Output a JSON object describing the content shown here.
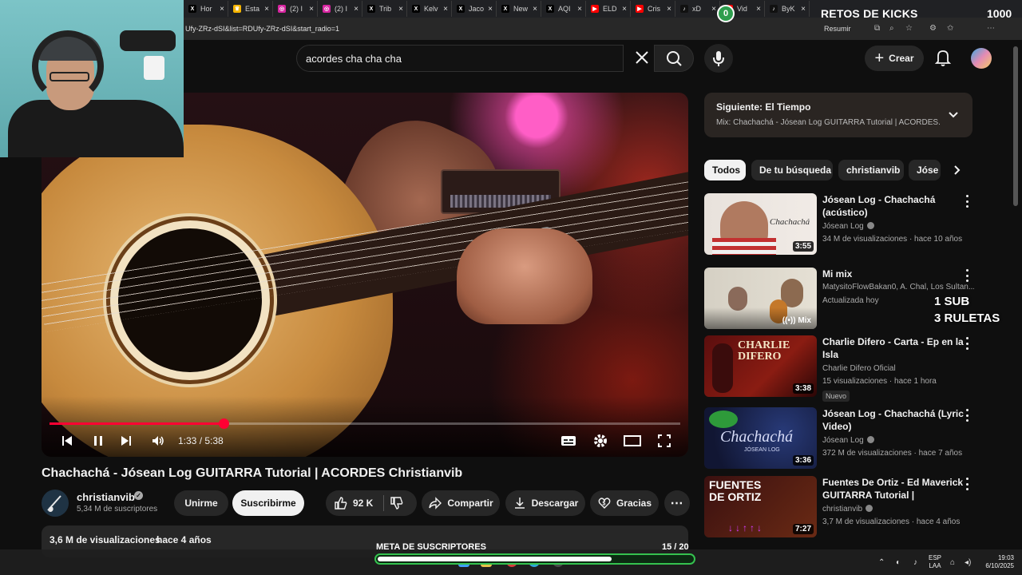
{
  "browser": {
    "tabs": [
      {
        "label": "Hor",
        "icon": "x-icon",
        "color": "#000000"
      },
      {
        "label": "Esta",
        "icon": "crown-icon",
        "color": "#f5b400"
      },
      {
        "label": "(2) I",
        "icon": "instagram-icon",
        "color": "#d6249f"
      },
      {
        "label": "(2) I",
        "icon": "instagram-icon",
        "color": "#d6249f"
      },
      {
        "label": "Trib",
        "icon": "x-icon",
        "color": "#000000"
      },
      {
        "label": "Kelv",
        "icon": "x-icon",
        "color": "#000000"
      },
      {
        "label": "Jaco",
        "icon": "x-icon",
        "color": "#000000"
      },
      {
        "label": "New",
        "icon": "x-icon",
        "color": "#000000"
      },
      {
        "label": "AQI",
        "icon": "x-icon",
        "color": "#000000"
      },
      {
        "label": "ELD",
        "icon": "youtube-icon",
        "color": "#ff0000"
      },
      {
        "label": "Cris",
        "icon": "youtube-icon",
        "color": "#ff0000"
      },
      {
        "label": "xD",
        "icon": "tiktok-icon",
        "color": "#111111"
      },
      {
        "label": "Vid",
        "icon": "youtube-icon",
        "color": "#ff0000"
      },
      {
        "label": "ByK",
        "icon": "tiktok-icon",
        "color": "#111111"
      }
    ],
    "url": "Ufy-ZRz-dSI&list=RDUfy-ZRz-dSI&start_radio=1",
    "resumir_label": "Resumir"
  },
  "stream": {
    "counter": "0",
    "challenge_title": "RETOS DE KICKS",
    "challenge_value": "1000",
    "sub_overlay": [
      "1 SUB",
      "3 RULETAS"
    ],
    "goal_label": "META DE SUSCRIPTORES",
    "goal_count": "15  / 20",
    "goal_progress": 0.75
  },
  "header": {
    "search_value": "acordes cha cha cha",
    "create_label": "Crear"
  },
  "player": {
    "time": "1:33 / 5:38",
    "progress": 0.276
  },
  "video": {
    "title": "Chachachá - Jósean Log GUITARRA Tutorial | ACORDES Christianvib",
    "channel": "christianvib",
    "subscribers": "5,34 M de suscriptores",
    "join_label": "Unirme",
    "subscribe_label": "Suscribirme",
    "likes": "92 K",
    "share_label": "Compartir",
    "download_label": "Descargar",
    "thanks_label": "Gracias",
    "views": "3,6 M de visualizaciones",
    "ago": "hace 4 años"
  },
  "playlist": {
    "next": "Siguiente: El Tiempo",
    "subtitle": "Mix: Chachachá - Jósean Log GUITARRA Tutorial | ACORDES..."
  },
  "chips": [
    "Todos",
    "De tu búsqueda",
    "christianvib",
    "Jóse"
  ],
  "recommendations": [
    {
      "title": "Jósean Log - Chachachá (acústico)",
      "channel": "Jósean Log",
      "verified": true,
      "meta": "34 M de visualizaciones · hace 10 años",
      "duration": "3:55",
      "badge": ""
    },
    {
      "title": "Mi mix",
      "channel": "MatysitoFlowBakan0, A. Chal, Los Sultan...",
      "verified": false,
      "meta": "Actualizada hoy",
      "duration": "Mix",
      "badge": ""
    },
    {
      "title": "Charlie Difero - Carta - Ep en la Isla",
      "channel": "Charlie Difero Oficial",
      "verified": false,
      "meta": "15 visualizaciones · hace 1 hora",
      "duration": "3:38",
      "badge": "Nuevo"
    },
    {
      "title": "Jósean Log - Chachachá (Lyric Video)",
      "channel": "Jósean Log",
      "verified": true,
      "meta": "372 M de visualizaciones · hace 7 años",
      "duration": "3:36",
      "badge": ""
    },
    {
      "title": "Fuentes De Ortiz - Ed Maverick GUITARRA Tutorial | ACORDES...",
      "channel": "christianvib",
      "verified": true,
      "meta": "3,7 M de visualizaciones · hace 4 años",
      "duration": "7:27",
      "badge": ""
    }
  ],
  "taskbar": {
    "lang": [
      "ESP",
      "LAA"
    ],
    "time": "19:03",
    "date": "6/10/2025"
  },
  "colors": {
    "accent_red": "#ff0033",
    "goal_green": "#35c24f",
    "background": "#0f0f0f"
  }
}
